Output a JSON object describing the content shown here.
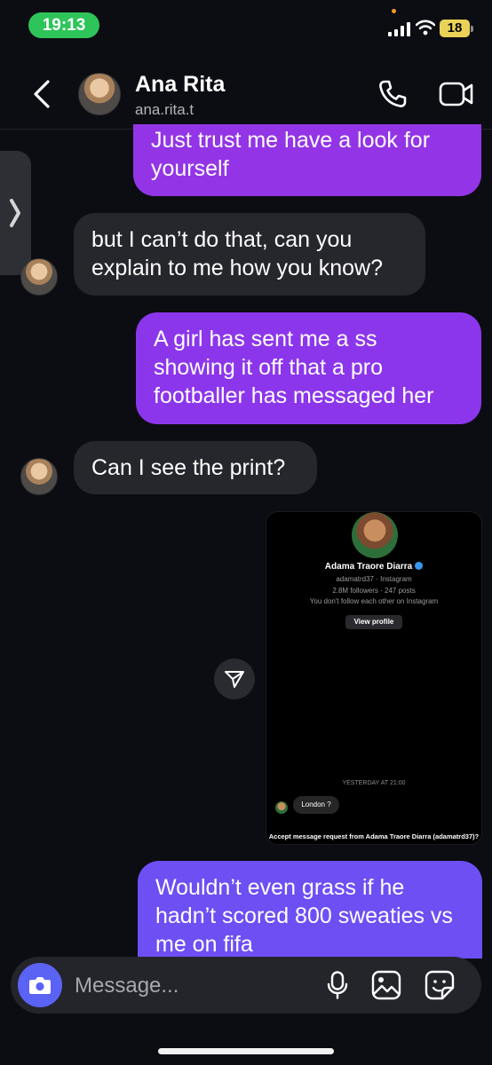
{
  "status_bar": {
    "time": "19:13",
    "battery": "18"
  },
  "header": {
    "contact_name": "Ana Rita",
    "contact_username": "ana.rita.t"
  },
  "messages": [
    {
      "direction": "outgoing",
      "text": "Just trust me have a look for yourself"
    },
    {
      "direction": "incoming",
      "text": "but I can’t do that, can you explain to me how you know?"
    },
    {
      "direction": "outgoing",
      "text": "A girl has sent me a ss showing it off that a pro footballer has messaged her"
    },
    {
      "direction": "incoming",
      "text": "Can I see the print?"
    },
    {
      "direction": "outgoing",
      "text": "Wouldn’t even grass if he hadn’t scored 800 sweaties vs me on fifa"
    }
  ],
  "shared_screenshot": {
    "profile_name": "Adama Traore Diarra",
    "profile_handle": "adamatrd37 · Instagram",
    "profile_stats": "2.8M followers · 247 posts",
    "follow_note": "You don't follow each other on Instagram",
    "view_profile": "View profile",
    "timestamp": "YESTERDAY AT 21:00",
    "message": "London ?",
    "accept_prompt": "Accept message request from Adama Traore Diarra (adamatrd37)?"
  },
  "composer": {
    "placeholder": "Message..."
  },
  "icons": {
    "back": "chevron-left-icon",
    "call": "phone-icon",
    "video": "video-camera-icon",
    "camera": "camera-icon",
    "mic": "microphone-icon",
    "gallery": "image-icon",
    "sticker": "sticker-icon",
    "share": "send-icon",
    "handle": "chevron-right-icon"
  },
  "colors": {
    "background": "#0c0d12",
    "incoming_bubble": "#26272d",
    "outgoing_bubble": "#9335e6",
    "outgoing_bubble_last": "#6d4ff4",
    "time_pill": "#2ec45a",
    "camera_button": "#5b63f5"
  }
}
